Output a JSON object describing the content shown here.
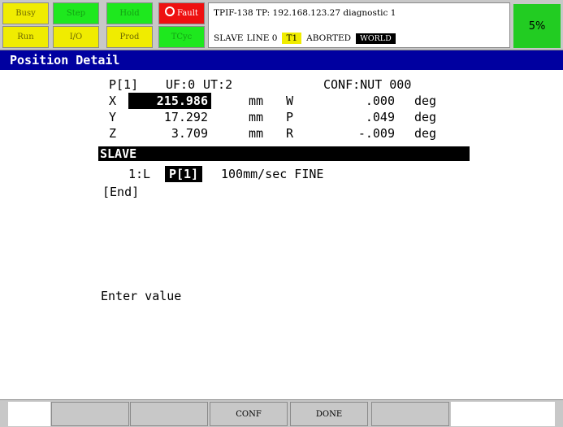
{
  "status": {
    "leds_row1": [
      {
        "label": "Busy",
        "color": "#f0ec00"
      },
      {
        "label": "Step",
        "color": "#1ee81e"
      },
      {
        "label": "Hold",
        "color": "#1ee81e"
      },
      {
        "label": "Fault",
        "color": "#ee1010",
        "icon": "ring-icon"
      }
    ],
    "leds_row2": [
      {
        "label": "Run",
        "color": "#f0ec00"
      },
      {
        "label": "I/O",
        "color": "#f0ec00"
      },
      {
        "label": "Prod",
        "color": "#f0ec00"
      },
      {
        "label": "TCyc",
        "color": "#1ee81e"
      }
    ],
    "info_line1": "TPIF-138 TP: 192.168.123.27 diagnostic 1",
    "program_name": "SLAVE",
    "line_label": "LINE 0",
    "mode_tag": "T1",
    "state": "ABORTED",
    "frame_tag": "WORLD",
    "override": "5%"
  },
  "title": "Position Detail",
  "position": {
    "ref": "P[1]",
    "uf": "UF:0",
    "ut": "UT:2",
    "conf": "CONF:NUT 000",
    "axes": [
      {
        "name": "X",
        "value": "215.986",
        "unit": "mm",
        "rot_name": "W",
        "rot_value": ".000",
        "rot_unit": "deg"
      },
      {
        "name": "Y",
        "value": "17.292",
        "unit": "mm",
        "rot_name": "P",
        "rot_value": ".049",
        "rot_unit": "deg"
      },
      {
        "name": "Z",
        "value": "3.709",
        "unit": "mm",
        "rot_name": "R",
        "rot_value": "-.009",
        "rot_unit": "deg"
      }
    ]
  },
  "program": {
    "name": "SLAVE",
    "line1_num": "1:L",
    "line1_pos": "P[1]",
    "line1_rest": "100mm/sec FINE",
    "end": "[End]"
  },
  "prompt": "Enter value",
  "fkeys": [
    "",
    "",
    "CONF",
    "DONE",
    ""
  ],
  "colors": {
    "title_bar": "#0000a0",
    "header_bg": "#c8c8c8",
    "override_bg": "#22cc22"
  }
}
